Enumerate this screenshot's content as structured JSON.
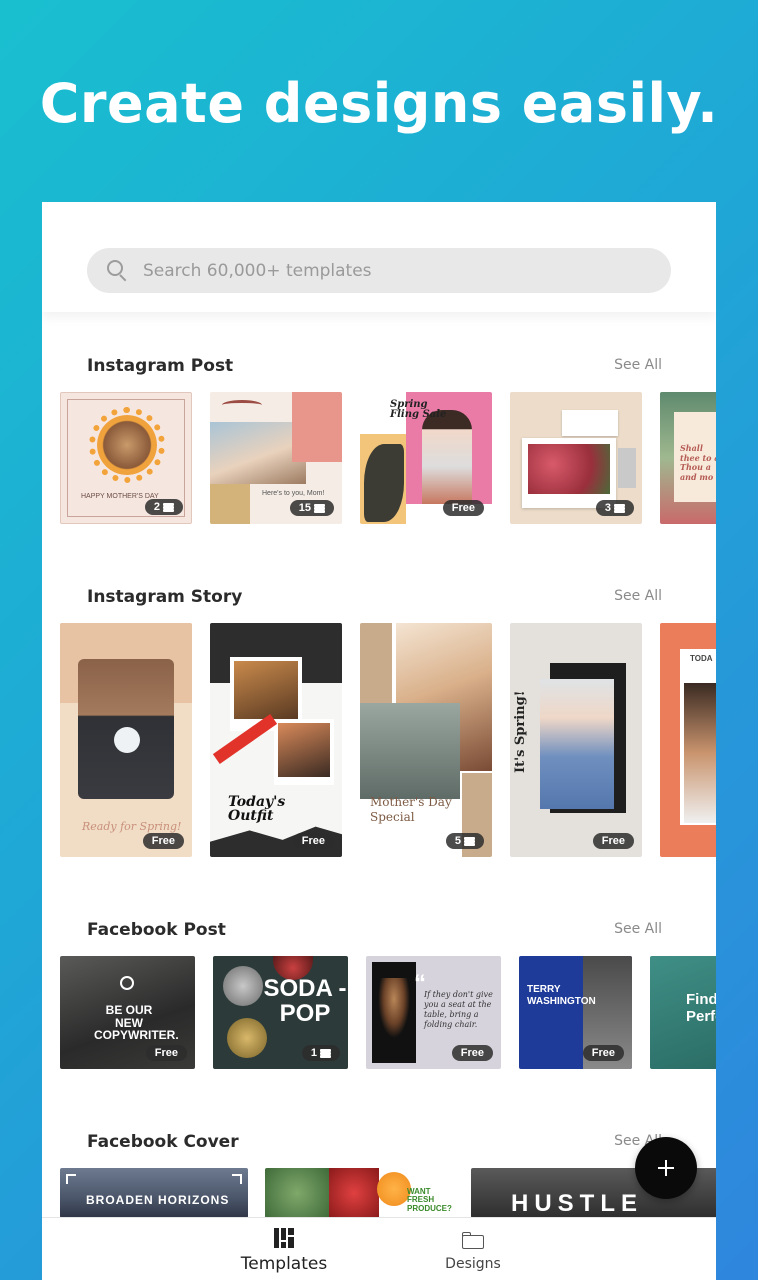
{
  "hero": {
    "title": "Create designs easily."
  },
  "search": {
    "placeholder": "Search 60,000+ templates"
  },
  "sections": [
    {
      "title": "Instagram Post",
      "see_all": "See All",
      "cards": [
        {
          "text": "HAPPY MOTHER'S DAY",
          "badge": "2"
        },
        {
          "text": "Here's to you, Mom!",
          "badge": "15"
        },
        {
          "text": "Spring Fling Sale",
          "badge": "Free"
        },
        {
          "text": "",
          "badge": "3"
        },
        {
          "text": "Shall thee to a Thou a and mo",
          "badge": ""
        }
      ]
    },
    {
      "title": "Instagram Story",
      "see_all": "See All",
      "cards": [
        {
          "text": "Ready for Spring!",
          "badge": "Free"
        },
        {
          "text": "Today's Outfit",
          "badge": "Free"
        },
        {
          "text": "Mother's Day Special",
          "badge": "5"
        },
        {
          "text": "It's Spring!",
          "badge": "Free"
        },
        {
          "text": "TODA",
          "badge": ""
        }
      ]
    },
    {
      "title": "Facebook Post",
      "see_all": "See All",
      "cards": [
        {
          "text": "BE OUR NEW COPYWRITER.",
          "badge": "Free"
        },
        {
          "text": "SODA - POP",
          "badge": "1"
        },
        {
          "text": "If they don't give you a seat at the table, bring a folding chair.",
          "badge": "Free"
        },
        {
          "text": "TERRY WASHINGTON",
          "badge": "Free"
        },
        {
          "text": "Find Perfec",
          "badge": ""
        }
      ]
    },
    {
      "title": "Facebook Cover",
      "see_all": "See All",
      "cards": [
        {
          "text": "BROADEN HORIZONS",
          "badge": ""
        },
        {
          "text": "WANT FRESH PRODUCE?",
          "badge": ""
        },
        {
          "text": "HUSTLE",
          "badge": ""
        }
      ]
    }
  ],
  "nav": {
    "templates": "Templates",
    "designs": "Designs"
  },
  "colors": {
    "gradient_start": "#19bfcf",
    "gradient_end": "#2f86dd",
    "fab": "#0a0a0a"
  }
}
